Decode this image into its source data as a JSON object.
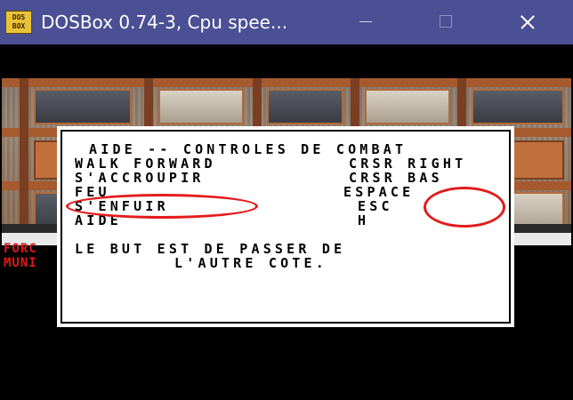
{
  "window": {
    "title": "DOSBox 0.74-3, Cpu spee...",
    "icon_text_top": "DOS",
    "icon_text_bottom": "BOX",
    "controls": [
      "minimize-icon",
      "maximize-icon",
      "close-icon"
    ]
  },
  "hud": {
    "line1": "FORC",
    "line2": "MUNI"
  },
  "help_dialog": {
    "heading": "AIDE -- CONTROLES DE COMBAT",
    "rows": [
      {
        "action": "WALK FORWARD",
        "key": "CRSR RIGHT"
      },
      {
        "action": "S'ACCROUPIR",
        "key": "CRSR BAS"
      },
      {
        "action": "FEU",
        "key": "ESPACE"
      },
      {
        "action": "S'ENFUIR",
        "key": "ESC"
      },
      {
        "action": "AIDE",
        "key": "H"
      }
    ],
    "footer_line1": "LE BUT EST DE PASSER DE",
    "footer_line2": "L'AUTRE COTE."
  },
  "colors": {
    "titlebar": "#4b4f94",
    "hud_text": "#e01818",
    "annotation": "#e31c1c"
  }
}
